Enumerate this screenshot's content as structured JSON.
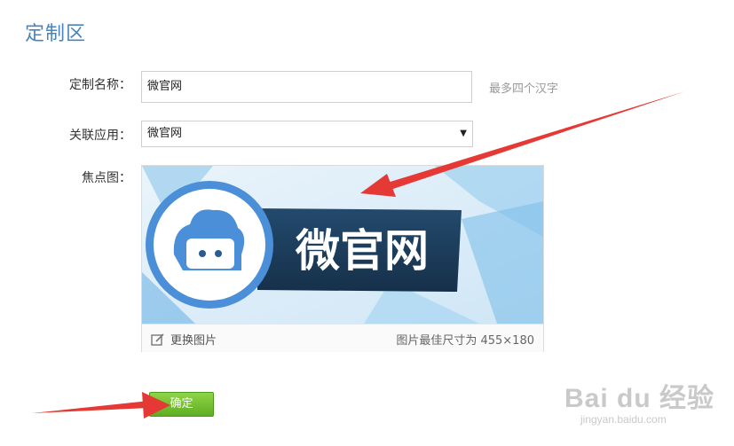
{
  "section_title": "定制区",
  "form": {
    "name_label": "定制名称：",
    "name_value": "微官网",
    "name_hint": "最多四个汉字",
    "app_label": "关联应用：",
    "app_value": "微官网",
    "focus_label": "焦点图："
  },
  "focus_image": {
    "banner_text": "微官网",
    "change_label": "更换图片",
    "size_hint": "图片最佳尺寸为 455×180"
  },
  "confirm_label": "确定",
  "watermark": {
    "logo_text": "Bai du 经验",
    "url": "jingyan.baidu.com"
  },
  "colors": {
    "title": "#4a84b8",
    "banner_dark": "#1e3d5c",
    "banner_blue": "#5b9fe0",
    "button_green": "#6ab82a",
    "annotation_red": "#e53935"
  }
}
